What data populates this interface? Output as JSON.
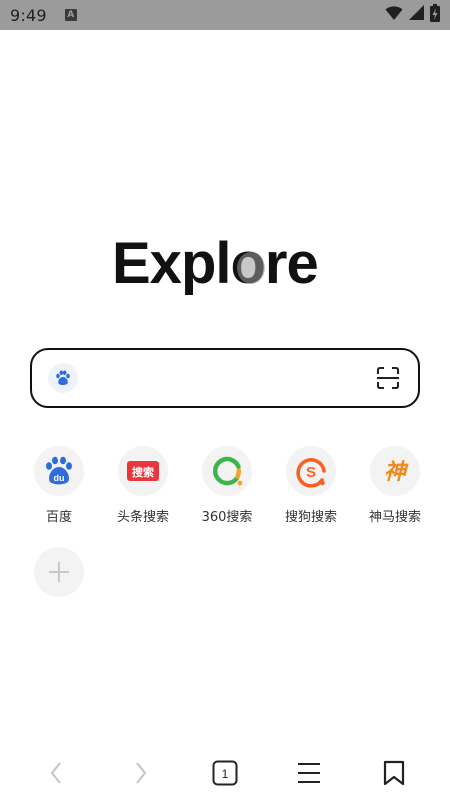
{
  "status_bar": {
    "time": "9:49",
    "notification_letter": "A",
    "icons": [
      "wifi-icon",
      "signal-icon",
      "battery-charging-icon"
    ]
  },
  "logo": {
    "text": "Explore"
  },
  "search": {
    "engine_icon": "baidu-paw-icon",
    "value": "",
    "placeholder": "",
    "scan_icon": "scan-icon"
  },
  "shortcuts": [
    {
      "label": "百度",
      "icon": "baidu-icon"
    },
    {
      "label": "头条搜索",
      "icon": "toutiao-search-icon",
      "badge_text": "搜索"
    },
    {
      "label": "360搜索",
      "icon": "360-search-icon"
    },
    {
      "label": "搜狗搜索",
      "icon": "sogou-icon"
    },
    {
      "label": "神马搜索",
      "icon": "shenma-icon",
      "badge_text": "神"
    }
  ],
  "add_shortcut": {
    "icon": "plus-icon"
  },
  "bottom_nav": {
    "back_icon": "chevron-left-icon",
    "forward_icon": "chevron-right-icon",
    "tab_count": "1",
    "menu_icon": "menu-icon",
    "bookmark_icon": "bookmark-icon"
  },
  "colors": {
    "status_bar_bg": "#9b9b9b",
    "baidu_blue": "#2f6bdc",
    "toutiao_red": "#e8363f",
    "green_360": "#3db54a",
    "orange_360": "#f5a623",
    "sogou_orange": "#fb6022",
    "shenma_orange": "#f08a1c"
  }
}
